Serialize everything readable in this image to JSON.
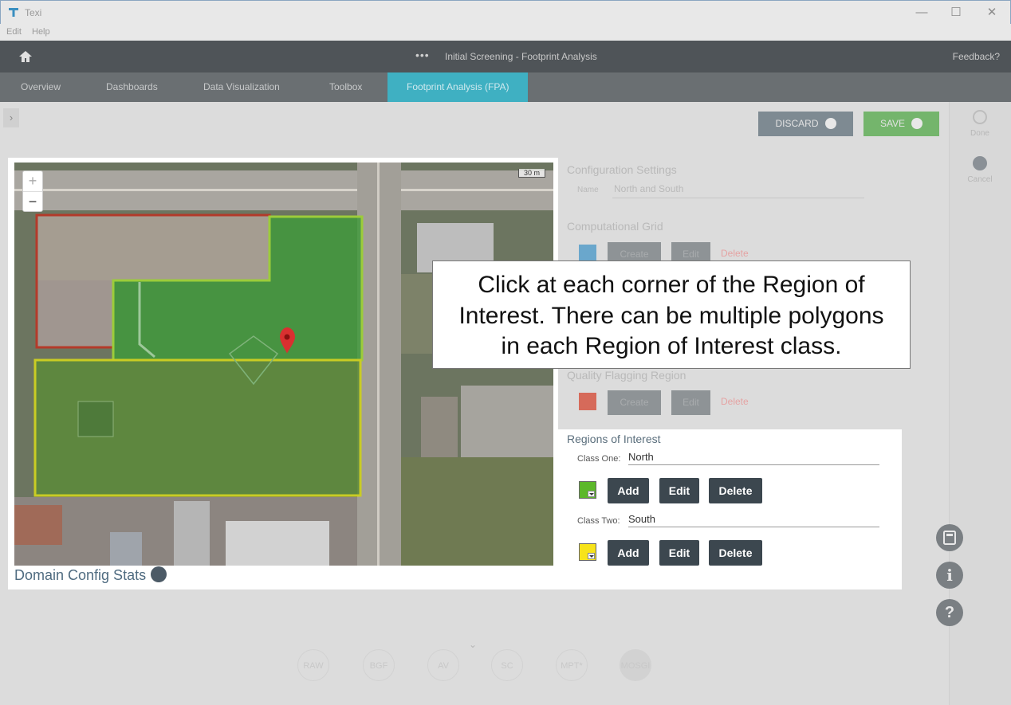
{
  "window": {
    "title": "Texi",
    "menu": [
      "Edit",
      "Help"
    ]
  },
  "header": {
    "title": "Initial Screening - Footprint Analysis",
    "dots": "•••",
    "feedback": "Feedback?"
  },
  "tabs": [
    "Overview",
    "Dashboards",
    "Data Visualization",
    "Toolbox",
    "Footprint Analysis (FPA)"
  ],
  "toolbar": {
    "discard": "DISCARD",
    "save": "SAVE"
  },
  "side_actions": {
    "done": "Done",
    "cancel": "Cancel"
  },
  "config": {
    "heading": "Configuration Settings",
    "name_label": "Name",
    "name_value": "North and South",
    "grid_heading": "Computational Grid",
    "create": "Create",
    "edit": "Edit",
    "delete": "Delete",
    "qfr_heading": "Quality Flagging Region"
  },
  "map": {
    "scale": "30 m",
    "zoom_in": "+",
    "zoom_out": "−",
    "stats_label": "Domain Config Stats"
  },
  "roi": {
    "title": "Regions of Interest",
    "class_one_label": "Class One:",
    "class_one_value": "North",
    "class_one_color": "#5cb82a",
    "class_two_label": "Class Two:",
    "class_two_value": "South",
    "class_two_color": "#f7e31a",
    "add": "Add",
    "edit": "Edit",
    "delete": "Delete"
  },
  "tooltip": {
    "line1": "Click at each corner of the Region of",
    "line2": "Interest. There can be multiple polygons",
    "line3": "in each Region of Interest class."
  },
  "fabs": [
    "calculator-icon",
    "info-icon",
    "help-icon"
  ],
  "fab_glyphs": {
    "info": "i",
    "help": "?"
  },
  "bottom_steps": [
    "RAW",
    "BGF",
    "AV",
    "SC",
    "MPT*",
    "MOSGI"
  ]
}
